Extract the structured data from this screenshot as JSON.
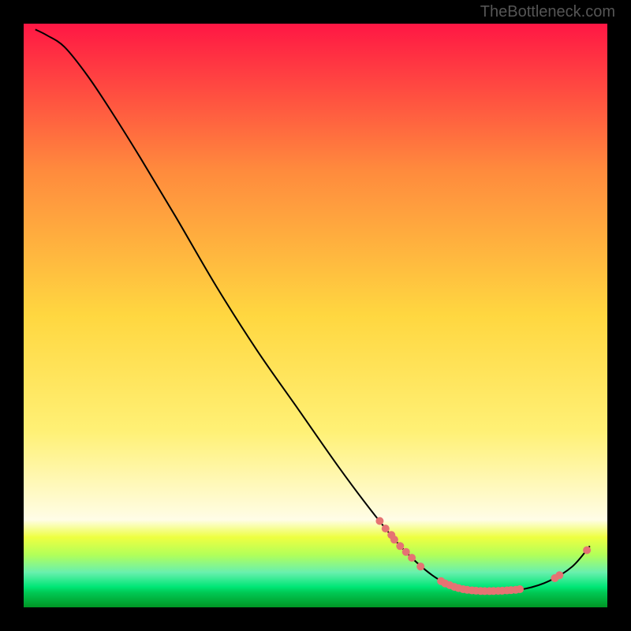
{
  "watermark": "TheBottleneck.com",
  "chart_data": {
    "type": "line",
    "title": "",
    "xlabel": "",
    "ylabel": "",
    "xlim": [
      0,
      100
    ],
    "ylim": [
      0,
      100
    ],
    "grid": false,
    "legend": false,
    "gradient_stops": [
      {
        "offset": 0.0,
        "color": "#ff1744"
      },
      {
        "offset": 0.25,
        "color": "#ff8a3d"
      },
      {
        "offset": 0.5,
        "color": "#ffd740"
      },
      {
        "offset": 0.7,
        "color": "#fff176"
      },
      {
        "offset": 0.85,
        "color": "#fffde7"
      },
      {
        "offset": 0.88,
        "color": "#eeff41"
      },
      {
        "offset": 0.91,
        "color": "#b2ff59"
      },
      {
        "offset": 0.94,
        "color": "#69f0ae"
      },
      {
        "offset": 0.965,
        "color": "#00e676"
      },
      {
        "offset": 0.975,
        "color": "#00c853"
      },
      {
        "offset": 1.0,
        "color": "#009624"
      }
    ],
    "series": [
      {
        "name": "bottleneck-curve",
        "type": "line",
        "color": "#000000",
        "points": [
          {
            "x": 2.0,
            "y": 99.0
          },
          {
            "x": 4.0,
            "y": 98.0
          },
          {
            "x": 7.0,
            "y": 96.0
          },
          {
            "x": 11.0,
            "y": 91.0
          },
          {
            "x": 15.0,
            "y": 85.0
          },
          {
            "x": 20.0,
            "y": 77.0
          },
          {
            "x": 26.0,
            "y": 67.0
          },
          {
            "x": 33.0,
            "y": 55.0
          },
          {
            "x": 40.0,
            "y": 44.0
          },
          {
            "x": 47.0,
            "y": 34.0
          },
          {
            "x": 54.0,
            "y": 24.0
          },
          {
            "x": 60.0,
            "y": 16.0
          },
          {
            "x": 65.0,
            "y": 10.0
          },
          {
            "x": 70.0,
            "y": 5.5
          },
          {
            "x": 74.0,
            "y": 3.5
          },
          {
            "x": 78.0,
            "y": 2.8
          },
          {
            "x": 82.0,
            "y": 2.8
          },
          {
            "x": 86.0,
            "y": 3.2
          },
          {
            "x": 90.0,
            "y": 4.5
          },
          {
            "x": 94.0,
            "y": 7.0
          },
          {
            "x": 97.0,
            "y": 10.5
          }
        ]
      },
      {
        "name": "highlight-dots",
        "type": "scatter",
        "color": "#e57373",
        "points": [
          {
            "x": 61.0,
            "y": 14.8
          },
          {
            "x": 62.0,
            "y": 13.5
          },
          {
            "x": 63.0,
            "y": 12.4
          },
          {
            "x": 63.5,
            "y": 11.6
          },
          {
            "x": 64.5,
            "y": 10.5
          },
          {
            "x": 65.5,
            "y": 9.5
          },
          {
            "x": 66.5,
            "y": 8.5
          },
          {
            "x": 68.0,
            "y": 7.0
          },
          {
            "x": 71.5,
            "y": 4.5
          },
          {
            "x": 72.2,
            "y": 4.1
          },
          {
            "x": 73.0,
            "y": 3.8
          },
          {
            "x": 73.8,
            "y": 3.5
          },
          {
            "x": 74.5,
            "y": 3.3
          },
          {
            "x": 75.3,
            "y": 3.1
          },
          {
            "x": 76.0,
            "y": 3.0
          },
          {
            "x": 76.8,
            "y": 2.9
          },
          {
            "x": 77.5,
            "y": 2.85
          },
          {
            "x": 78.3,
            "y": 2.8
          },
          {
            "x": 79.0,
            "y": 2.78
          },
          {
            "x": 79.8,
            "y": 2.78
          },
          {
            "x": 80.5,
            "y": 2.8
          },
          {
            "x": 81.3,
            "y": 2.82
          },
          {
            "x": 82.0,
            "y": 2.85
          },
          {
            "x": 82.8,
            "y": 2.9
          },
          {
            "x": 83.5,
            "y": 2.95
          },
          {
            "x": 84.3,
            "y": 3.0
          },
          {
            "x": 85.0,
            "y": 3.1
          },
          {
            "x": 91.0,
            "y": 5.0
          },
          {
            "x": 91.8,
            "y": 5.5
          },
          {
            "x": 96.5,
            "y": 9.8
          }
        ]
      }
    ]
  }
}
